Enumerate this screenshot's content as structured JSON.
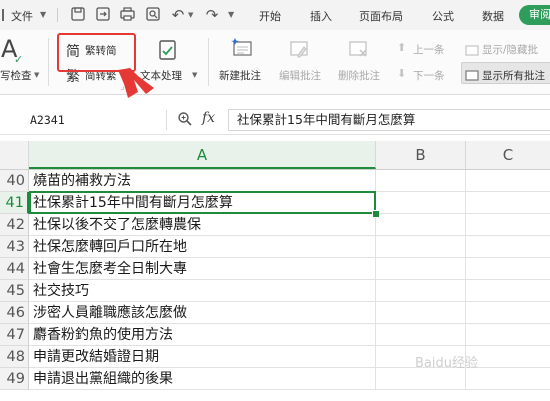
{
  "menubar": {
    "file_label": "文件",
    "tabs": [
      {
        "label": "开始"
      },
      {
        "label": "插入"
      },
      {
        "label": "页面布局"
      },
      {
        "label": "公式"
      },
      {
        "label": "数据"
      },
      {
        "label": "审阅"
      }
    ],
    "active_tab": "审阅"
  },
  "ribbon": {
    "spell_check": "写检查",
    "trad_simp": "繁转简",
    "simp_trad": "简转繁",
    "text_processing": "文本处理",
    "new_comment": "新建批注",
    "edit_comment": "编辑批注",
    "delete_comment": "删除批注",
    "prev": "上一条",
    "next": "下一条",
    "show_hide_comment": "显示/隐藏批",
    "show_all_comments": "显示所有批注"
  },
  "formula_bar": {
    "name_box": "A2341",
    "fx_label": "fx",
    "content": "社保累計15年中間有斷月怎麼算"
  },
  "columns": [
    "A",
    "B",
    "C"
  ],
  "rows": [
    {
      "num": "40",
      "a": "燒苗的補救方法"
    },
    {
      "num": "41",
      "a": "社保累計15年中間有斷月怎麼算"
    },
    {
      "num": "42",
      "a": "社保以後不交了怎麼轉農保"
    },
    {
      "num": "43",
      "a": "社保怎麼轉回戶口所在地"
    },
    {
      "num": "44",
      "a": "社會生怎麼考全日制大專"
    },
    {
      "num": "45",
      "a": "社交技巧"
    },
    {
      "num": "46",
      "a": "涉密人員離職應該怎麼做"
    },
    {
      "num": "47",
      "a": "麝香粉釣魚的使用方法"
    },
    {
      "num": "48",
      "a": "申請更改結婚證日期"
    },
    {
      "num": "49",
      "a": "申請退出黨組織的後果"
    }
  ],
  "watermark": "Baidu经验",
  "colors": {
    "accent": "#1e8a3c",
    "highlight": "#e53935",
    "review_tab": "#2e9c5a"
  }
}
